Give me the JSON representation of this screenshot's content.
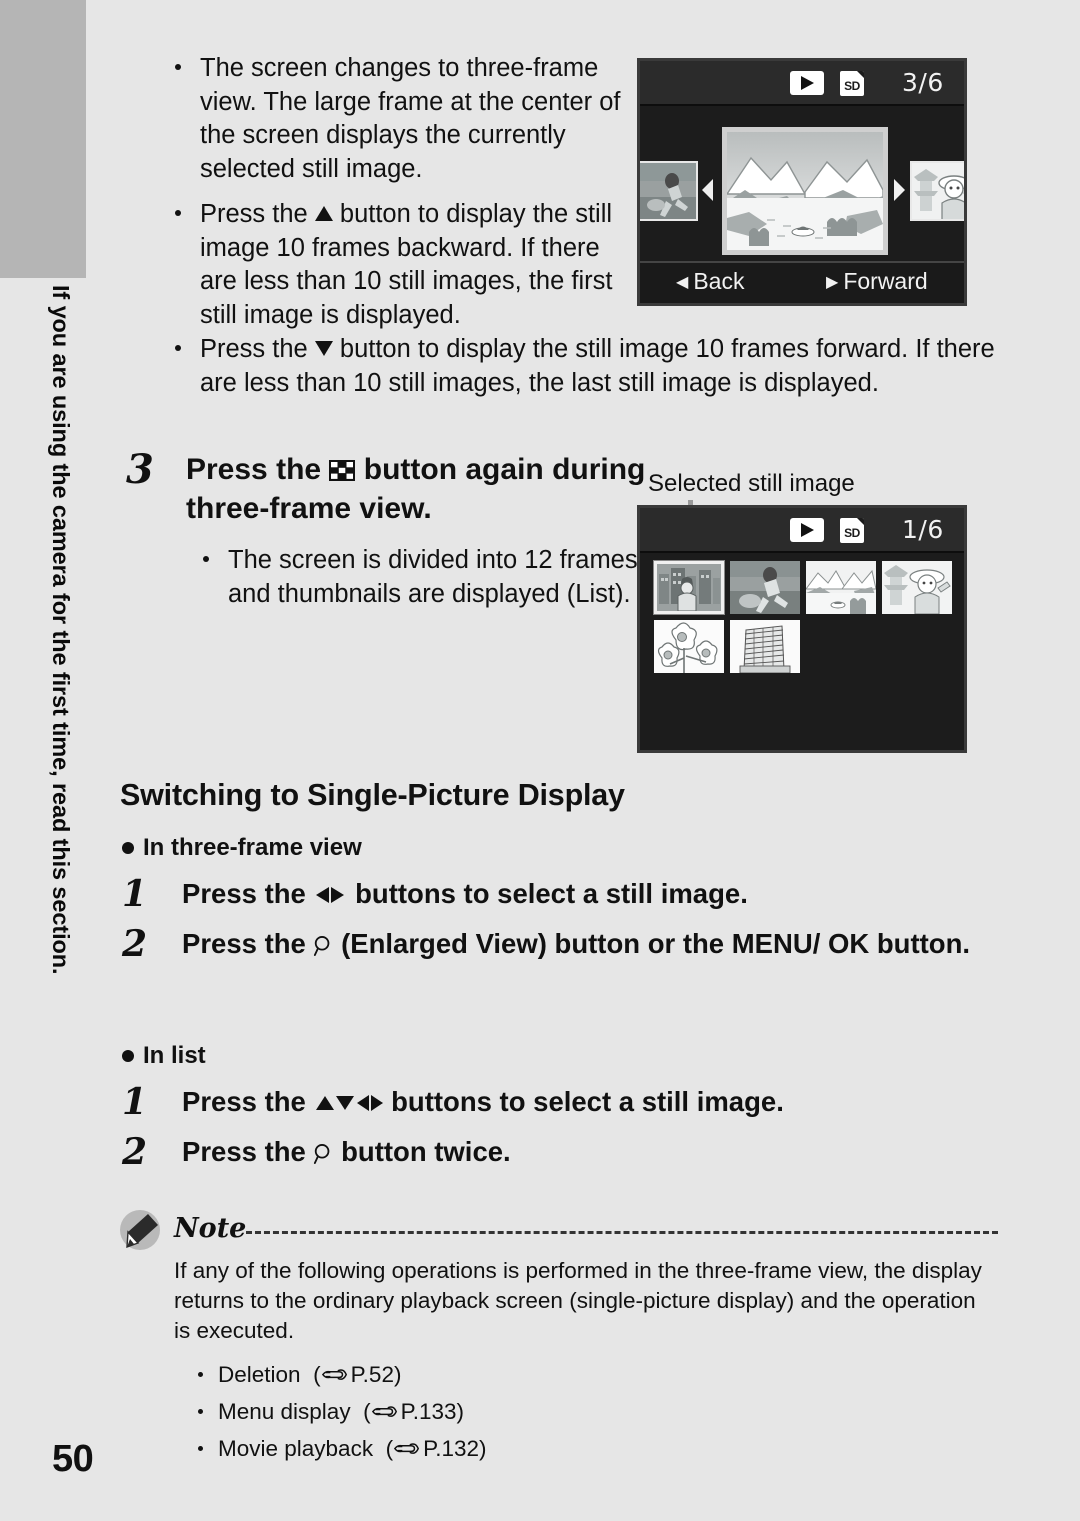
{
  "page": {
    "number": "50",
    "background_color": "#e6e6e6",
    "tab_color": "#b5b5b5"
  },
  "sidebar": {
    "vertical_text": "If you are using the camera for the first time, read this section."
  },
  "intro_bullets": [
    {
      "id": "bullet-three-frame-view",
      "text_before": "The screen changes to three-frame view. The large frame at the center of the screen displays the currently selected still image.",
      "icon": null,
      "text_after": ""
    },
    {
      "id": "bullet-up-button",
      "text_before": "Press the ",
      "icon": "up-triangle-icon",
      "text_after": " button to display the still image 10 frames backward. If there are less than 10 still images, the first still image is displayed."
    },
    {
      "id": "bullet-down-button",
      "text_before": "Press the ",
      "icon": "down-triangle-icon",
      "text_after": " button to display the still image 10 frames forward. If there are less than 10 still images, the last still image is displayed."
    }
  ],
  "step3": {
    "number": "3",
    "heading_before": "Press the ",
    "heading_icon": "thumbnail-grid-button-icon",
    "heading_after": " button again during three-frame view.",
    "bullet": "The screen is divided into 12 frames and thumbnails are displayed (List)."
  },
  "lcd_three_frame": {
    "name": "three-frame-view-screen",
    "status": {
      "play_icon": "play-icon",
      "card_icon": "sd-card-icon",
      "card_label": "SD",
      "frame_count": "3/6"
    },
    "footer": {
      "back_label": "Back",
      "back_arrow": "left-triangle-icon",
      "forward_label": "Forward",
      "forward_arrow": "right-triangle-icon"
    },
    "left_thumb": "runner-photo",
    "center_image": "mountain-lake-photo",
    "right_thumb": "woman-pagoda-photo",
    "nav_left": "nav-left-arrow",
    "nav_right": "nav-right-arrow"
  },
  "callout": {
    "label": "Selected still image"
  },
  "lcd_list": {
    "name": "list-view-screen",
    "status": {
      "play_icon": "play-icon",
      "card_icon": "sd-card-icon",
      "card_label": "SD",
      "frame_count": "1/6"
    },
    "thumbnails": [
      {
        "name": "thumbnail-city-person",
        "selected": true
      },
      {
        "name": "thumbnail-runner",
        "selected": false
      },
      {
        "name": "thumbnail-mountain-lake",
        "selected": false
      },
      {
        "name": "thumbnail-woman-pagoda",
        "selected": false
      },
      {
        "name": "thumbnail-flowers",
        "selected": false
      },
      {
        "name": "thumbnail-building",
        "selected": false
      }
    ]
  },
  "section": {
    "title": "Switching to Single-Picture Display",
    "group_three_frame": {
      "heading": "In three-frame view",
      "steps": [
        {
          "number": "1",
          "text_before": "Press the ",
          "icon": "left-right-arrows-icon",
          "text_after": " buttons to select a still image."
        },
        {
          "number": "2",
          "text_before": "Press the ",
          "icon": "magnifier-enlarged-view-icon",
          "text_after": " (Enlarged View) button or the MENU/ OK button."
        }
      ]
    },
    "group_list": {
      "heading": "In list",
      "steps": [
        {
          "number": "1",
          "text_before": "Press the ",
          "icon": "four-way-arrows-icon",
          "text_after": " buttons to select a still image."
        },
        {
          "number": "2",
          "text_before": "Press the ",
          "icon": "magnifier-enlarged-view-icon",
          "text_after": " button twice."
        }
      ]
    }
  },
  "note": {
    "icon": "pencil-note-icon",
    "title": "Note",
    "body": "If any of the following operations is performed in the three-frame view, the display returns to the ordinary playback screen (single-picture display) and the operation is executed.",
    "references": [
      {
        "label": "Deletion",
        "ref_icon": "pointing-hand-icon",
        "page": "P.52"
      },
      {
        "label": "Menu display",
        "ref_icon": "pointing-hand-icon",
        "page": "P.133"
      },
      {
        "label": "Movie playback",
        "ref_icon": "pointing-hand-icon",
        "page": "P.132"
      }
    ]
  }
}
